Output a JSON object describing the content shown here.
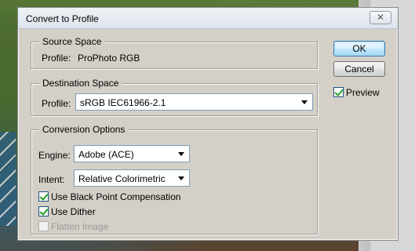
{
  "window": {
    "title": "Convert to Profile",
    "close_glyph": "✕"
  },
  "source_space": {
    "legend": "Source Space",
    "profile_label": "Profile:",
    "profile_value": "ProPhoto RGB"
  },
  "destination_space": {
    "legend": "Destination Space",
    "profile_label": "Profile:",
    "profile_selected": "sRGB IEC61966-2.1"
  },
  "conversion_options": {
    "legend": "Conversion Options",
    "engine_label": "Engine:",
    "engine_selected": "Adobe (ACE)",
    "intent_label": "Intent:",
    "intent_selected": "Relative Colorimetric",
    "checkboxes": [
      {
        "label": "Use Black Point Compensation",
        "checked": true,
        "enabled": true
      },
      {
        "label": "Use Dither",
        "checked": true,
        "enabled": true
      },
      {
        "label": "Flatten Image",
        "checked": false,
        "enabled": false
      }
    ]
  },
  "buttons": {
    "ok": "OK",
    "cancel": "Cancel"
  },
  "preview": {
    "label": "Preview",
    "checked": true
  },
  "icons": {
    "close": "close-icon",
    "dropdown": "chevron-down-icon"
  }
}
